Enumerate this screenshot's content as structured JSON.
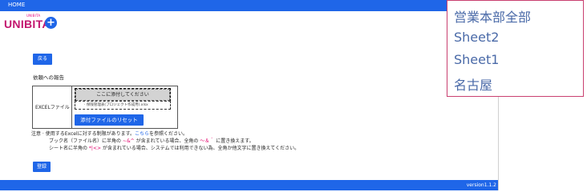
{
  "header": {
    "home_label": "HOME"
  },
  "logo": {
    "text": "UNIBITA",
    "tagline": "UNIBITA"
  },
  "back_button": "戻る",
  "section_title": "依頼への報告",
  "excel": {
    "label": "EXCELファイル",
    "dropzone_text": "ここに添付してください",
    "files": [
      "· 保険管理表(プロジェクト作成用).xlsx"
    ],
    "reset_button": "添付ファイルのリセット"
  },
  "notes": {
    "line1_prefix": "注意 · 使用するExcelに対する制限があります。",
    "line1_link": "こちら",
    "line1_suffix": "を参照ください。",
    "line2_prefix": "ブック名（ファイル名）に半角の ",
    "line2_red1": "~&^",
    "line2_mid": " が含まれている場合、全角の ",
    "line2_red2": "～＆＾",
    "line2_suffix": " に置き換えます。",
    "line3_prefix": "シート名に半角の ",
    "line3_red": "*|<>",
    "line3_suffix": " が含まれている場合、システムでは利用できない為、全角か他文字に置き換えてください。"
  },
  "register_button": "登録",
  "footer": {
    "version": "version1.1.2"
  },
  "sheet_popup": {
    "items": [
      "営業本部全部",
      "Sheet2",
      "Sheet1",
      "名古屋"
    ]
  },
  "colors": {
    "primary": "#1f66e8",
    "brand_pink": "#c3176f",
    "warning_red": "#e0006a",
    "popup_border": "#c94070"
  }
}
